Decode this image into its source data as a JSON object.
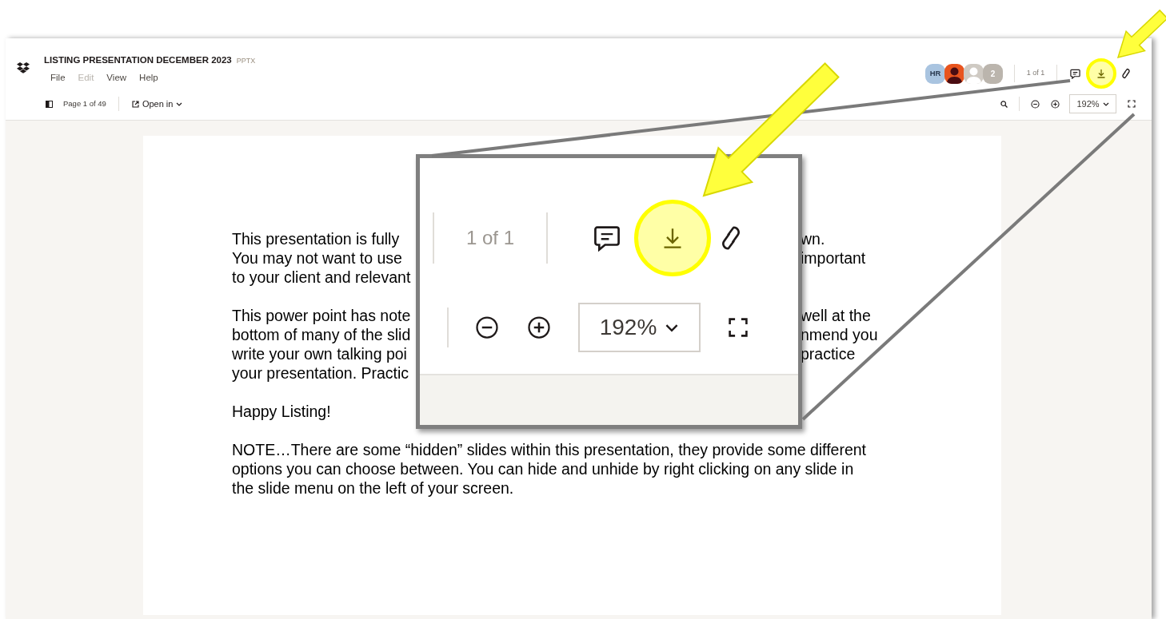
{
  "title": "LISTING PRESENTATION DECEMBER 2023",
  "file_type": "PPTX",
  "menu": [
    {
      "label": "File",
      "disabled": false
    },
    {
      "label": "Edit",
      "disabled": true
    },
    {
      "label": "View",
      "disabled": false
    },
    {
      "label": "Help",
      "disabled": false
    }
  ],
  "page_indicator": "Page 1 of 49",
  "open_in": "Open in",
  "collaborators": [
    {
      "kind": "initials",
      "label": "HR",
      "color": "#a9c4e0"
    },
    {
      "kind": "photo",
      "color": "#e8541e"
    },
    {
      "kind": "placeholder",
      "color": "#cfcac3"
    },
    {
      "kind": "count",
      "label": "2",
      "color": "#bbb5ad"
    }
  ],
  "page_count": "1 of 1",
  "zoom": "192%",
  "slide": {
    "paragraphs": [
      [
        {
          "left": "This presentation is fully",
          "right": "wn."
        },
        {
          "left": "You may not want to use",
          "right": "important"
        },
        {
          "left": "to your client and relevant"
        }
      ],
      [
        {
          "left": "This power point has note",
          "right": "well at the"
        },
        {
          "left": "bottom of many of the slid",
          "right": "nmend you"
        },
        {
          "left": "write your own talking poi",
          "right": "practice"
        },
        {
          "left": "your presentation.  Practic"
        }
      ],
      [
        {
          "left": "Happy Listing!"
        }
      ],
      [
        {
          "left": "NOTE…There are some “hidden” slides within this presentation, they provide some different"
        },
        {
          "left": "options you can choose between. You can hide and unhide by right clicking on any slide in"
        },
        {
          "left": "the slide menu on the left of your screen."
        }
      ]
    ]
  },
  "callout": {
    "page_count": "1 of 1",
    "zoom": "192%"
  }
}
